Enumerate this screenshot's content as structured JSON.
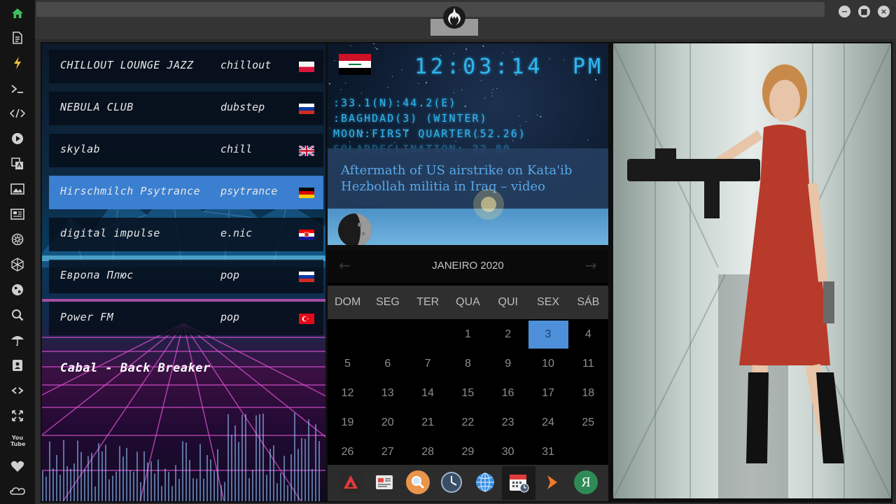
{
  "rail": {
    "items": [
      "home-icon",
      "document-icon",
      "bolt-icon",
      "terminal-icon",
      "code-icon",
      "play-icon",
      "translate-icon",
      "image-icon",
      "news-icon",
      "settings-gear-icon",
      "hexagon-icon",
      "globe-icon",
      "search-icon",
      "umbrella-icon",
      "contact-card-icon",
      "link-icon",
      "fullscreen-icon",
      "youtube-icon",
      "heart-icon",
      "cloud-link-icon"
    ],
    "youtube_label": "You Tube"
  },
  "window": {
    "minimize": "−",
    "maximize": "■",
    "close": "×"
  },
  "radio": {
    "stations": [
      {
        "name": "CHILLOUT LOUNGE JAZZ",
        "genre": "chillout",
        "flag": "poland"
      },
      {
        "name": "NEBULA CLUB",
        "genre": "dubstep",
        "flag": "russia"
      },
      {
        "name": "skylab",
        "genre": "chill",
        "flag": "uk"
      },
      {
        "name": "Hirschmilch Psytrance",
        "genre": "psytrance",
        "flag": "germany",
        "active": true
      },
      {
        "name": "digital impulse",
        "genre": "e.nic",
        "flag": "croatia"
      },
      {
        "name": "Европа Плюс",
        "genre": "pop",
        "flag": "russia"
      },
      {
        "name": "Power FM",
        "genre": "pop",
        "flag": "turkey"
      }
    ],
    "now_playing": "Cabal - Back Breaker"
  },
  "clock": {
    "time": "12:03:14",
    "ampm": "PM",
    "coords": ":33.1(N):44.2(E)",
    "city": ":BAGHDAD(3) (WINTER)",
    "moon": "MOON:FIRST QUARTER(52.26)",
    "solar": "SOLARDECLINATION: 22.80",
    "flag": "iraq",
    "news": "Aftermath of US airstrike on Kata'ib Hezbollah militia in Iraq – video"
  },
  "calendar": {
    "title": "JANEIRO 2020",
    "prev": "←",
    "next": "→",
    "days_of_week": [
      "DOM",
      "SEG",
      "TER",
      "QUA",
      "QUI",
      "SEX",
      "SÁB"
    ],
    "first_weekday": 3,
    "days_in_month": 31,
    "today": 3
  },
  "dock": {
    "apps": [
      "arch-icon",
      "news-reader-icon",
      "magnifier-icon",
      "clock-icon",
      "globe-icon",
      "calendar-icon",
      "play-arrow-icon",
      "yandex-icon"
    ],
    "active": "calendar-icon",
    "yandex_letter": "Я"
  },
  "colors": {
    "accent": "#4e8fd9",
    "lcd": "#2fb6f0",
    "station_active": "#3a7fd0",
    "home": "#3fbf5f"
  }
}
